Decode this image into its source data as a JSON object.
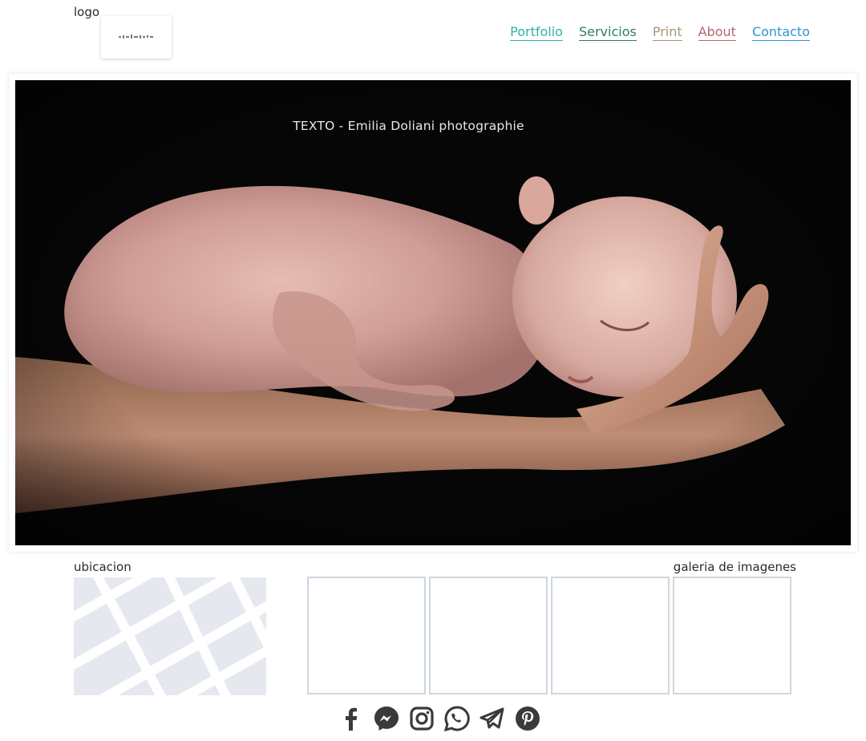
{
  "header": {
    "logo_label": "logo",
    "nav": [
      "Portfolio",
      "Servicios",
      "Print",
      "About",
      "Contacto"
    ]
  },
  "hero": {
    "caption": "TEXTO -  Emilia Doliani  photographie"
  },
  "location": {
    "label": "ubicacion"
  },
  "gallery": {
    "label": "galeria de imagenes",
    "thumbnails": 4
  },
  "social": {
    "icons": [
      "facebook-icon",
      "messenger-icon",
      "instagram-icon",
      "whatsapp-icon",
      "telegram-icon",
      "pinterest-icon"
    ],
    "icon_color": "#3a3a3a"
  },
  "colors": {
    "portfolio": "#2fb3a0",
    "servicios": "#2c7d63",
    "print": "#a99670",
    "about": "#b4686e",
    "contacto": "#2f94d6"
  }
}
